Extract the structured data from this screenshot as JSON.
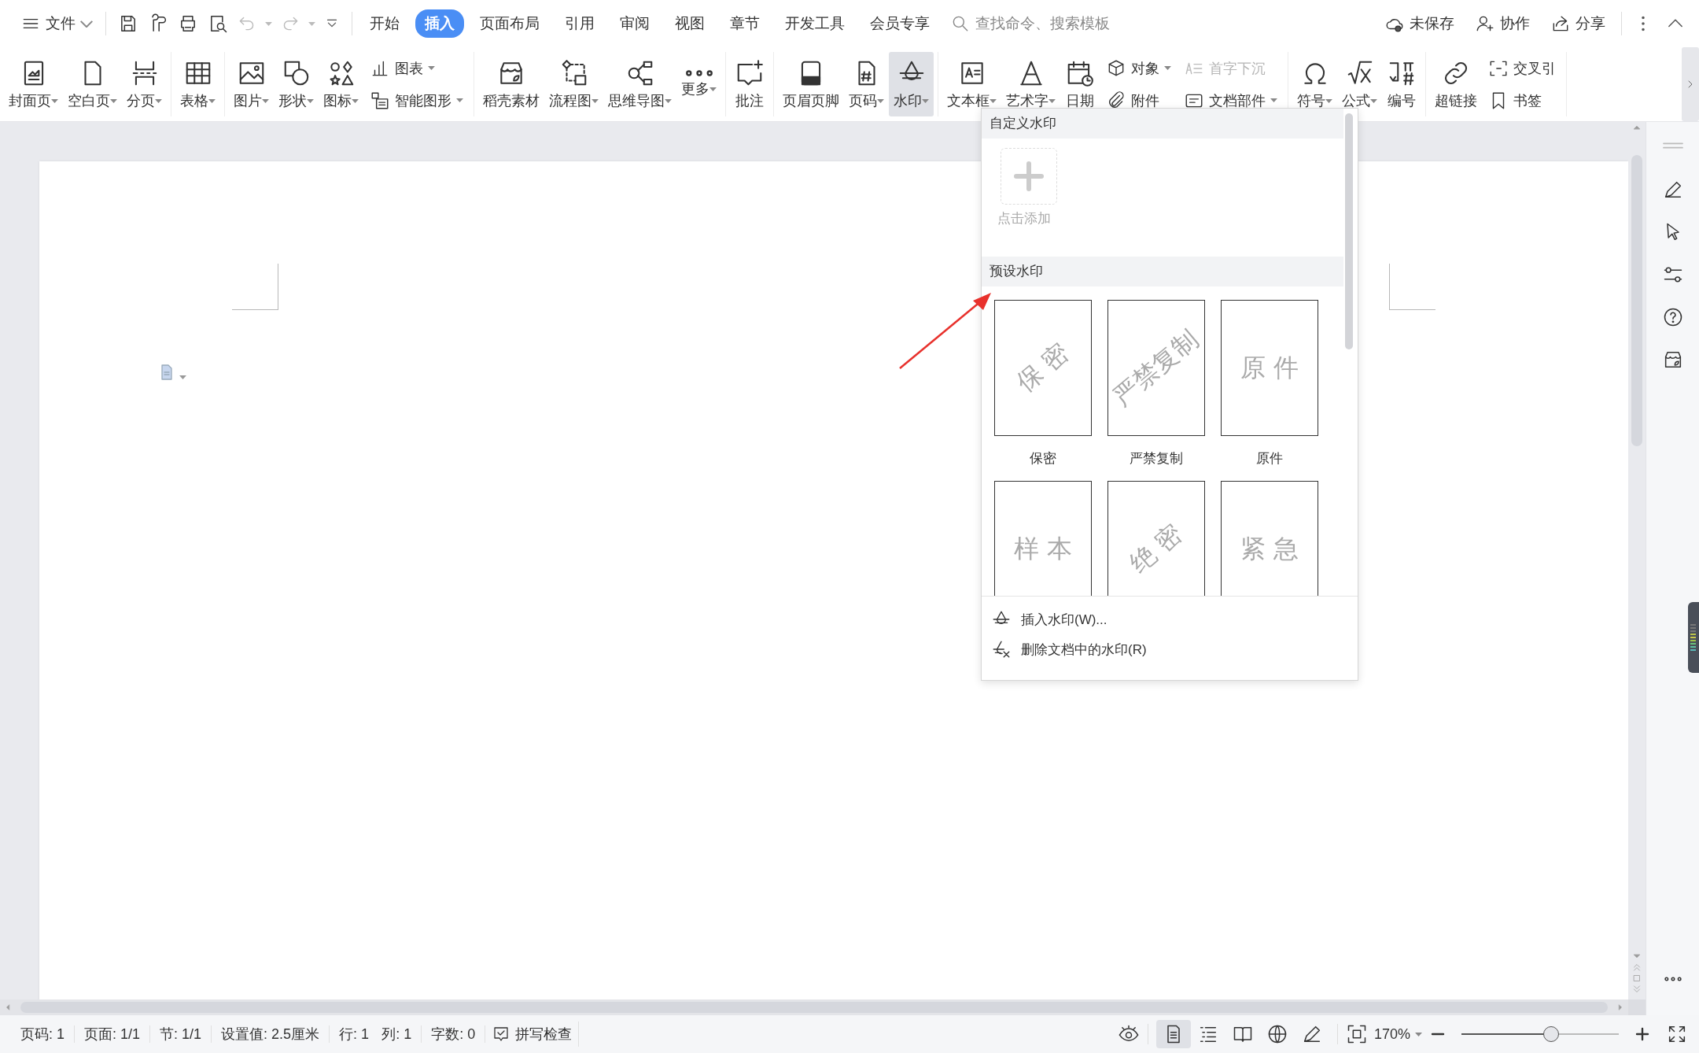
{
  "title_bar": {
    "file_menu": "文件",
    "tabs": [
      {
        "label": "开始",
        "selected": false
      },
      {
        "label": "插入",
        "selected": true
      },
      {
        "label": "页面布局",
        "selected": false
      },
      {
        "label": "引用",
        "selected": false
      },
      {
        "label": "审阅",
        "selected": false
      },
      {
        "label": "视图",
        "selected": false
      },
      {
        "label": "章节",
        "selected": false
      },
      {
        "label": "开发工具",
        "selected": false
      },
      {
        "label": "会员专享",
        "selected": false
      }
    ],
    "search": {
      "placeholder": "查找命令、搜索模板"
    },
    "actions": [
      "未保存",
      "协作",
      "分享"
    ]
  },
  "ribbon": {
    "groups": [
      [
        {
          "kind": "large",
          "label": "封面页",
          "dropdown": true,
          "expanded": false
        },
        {
          "kind": "large",
          "label": "空白页",
          "dropdown": true,
          "expanded": false
        },
        {
          "kind": "large",
          "label": "分页",
          "dropdown": true,
          "expanded": false
        }
      ],
      [
        {
          "kind": "large",
          "label": "表格",
          "dropdown": true,
          "expanded": false
        }
      ],
      [
        {
          "kind": "large",
          "label": "图片",
          "dropdown": true,
          "expanded": false
        },
        {
          "kind": "large",
          "label": "形状",
          "dropdown": true,
          "expanded": false
        },
        {
          "kind": "large",
          "label": "图标",
          "dropdown": true,
          "expanded": false
        },
        {
          "kind": "stack",
          "items": [
            {
              "label": "图表",
              "dropdown": true,
              "disabled": false
            },
            {
              "label": "智能图形",
              "dropdown": true,
              "disabled": false
            }
          ]
        }
      ],
      [
        {
          "kind": "large",
          "label": "稻壳素材",
          "dropdown": false,
          "expanded": false
        },
        {
          "kind": "large",
          "label": "流程图",
          "dropdown": true,
          "expanded": false
        },
        {
          "kind": "large",
          "label": "思维导图",
          "dropdown": true,
          "expanded": false
        },
        {
          "kind": "large",
          "label": "更多",
          "dropdown": true,
          "expanded": false
        }
      ],
      [
        {
          "kind": "large",
          "label": "批注",
          "dropdown": false,
          "expanded": false
        }
      ],
      [
        {
          "kind": "large",
          "label": "页眉页脚",
          "dropdown": false,
          "expanded": false
        },
        {
          "kind": "large",
          "label": "页码",
          "dropdown": true,
          "expanded": false
        },
        {
          "kind": "large",
          "label": "水印",
          "dropdown": true,
          "expanded": true
        }
      ],
      [
        {
          "kind": "large",
          "label": "文本框",
          "dropdown": true,
          "expanded": false
        },
        {
          "kind": "large",
          "label": "艺术字",
          "dropdown": true,
          "expanded": false
        },
        {
          "kind": "large",
          "label": "日期",
          "dropdown": false,
          "expanded": false
        },
        {
          "kind": "stack",
          "items": [
            {
              "label": "对象",
              "dropdown": true,
              "disabled": false
            },
            {
              "label": "附件",
              "dropdown": false,
              "disabled": false
            }
          ]
        },
        {
          "kind": "stack",
          "items": [
            {
              "label": "首字下沉",
              "dropdown": false,
              "disabled": true
            },
            {
              "label": "文档部件",
              "dropdown": true,
              "disabled": false
            }
          ]
        }
      ],
      [
        {
          "kind": "large",
          "label": "符号",
          "dropdown": true,
          "expanded": false
        },
        {
          "kind": "large",
          "label": "公式",
          "dropdown": true,
          "expanded": false
        },
        {
          "kind": "large",
          "label": "编号",
          "dropdown": false,
          "expanded": false
        }
      ],
      [
        {
          "kind": "large",
          "label": "超链接",
          "dropdown": false,
          "expanded": false
        },
        {
          "kind": "stack",
          "items": [
            {
              "label": "交叉引",
              "dropdown": false,
              "disabled": false
            },
            {
              "label": "书签",
              "dropdown": false,
              "disabled": false
            }
          ]
        }
      ]
    ]
  },
  "watermark_menu": {
    "custom_section": {
      "title": "自定义水印",
      "add_label": "点击添加"
    },
    "preset_section": {
      "title": "预设水印",
      "presets": [
        {
          "label": "保密",
          "watermark": "保 密",
          "tilted": true
        },
        {
          "label": "严禁复制",
          "watermark": "严禁复制",
          "tilted": true
        },
        {
          "label": "原件",
          "watermark": "原 件",
          "tilted": false
        },
        {
          "watermark": "样 本",
          "tilted": false
        },
        {
          "watermark": "绝 密",
          "tilted": true
        },
        {
          "watermark": "紧 急",
          "tilted": false
        }
      ]
    },
    "actions": [
      "插入水印(W)...",
      "删除文档中的水印(R)"
    ]
  },
  "status_bar": {
    "fields": [
      "页码: 1",
      "页面: 1/1",
      "节: 1/1",
      "设置值: 2.5厘米",
      "行: 1",
      "列: 1",
      "字数: 0"
    ],
    "spell_check": "拼写检查",
    "view_modes": [
      {
        "selected": true
      },
      {
        "selected": false
      },
      {
        "selected": false
      },
      {
        "selected": false
      },
      {
        "selected": false
      }
    ],
    "zoom": "170%",
    "zoom_slider": {
      "level": 0.57
    }
  }
}
